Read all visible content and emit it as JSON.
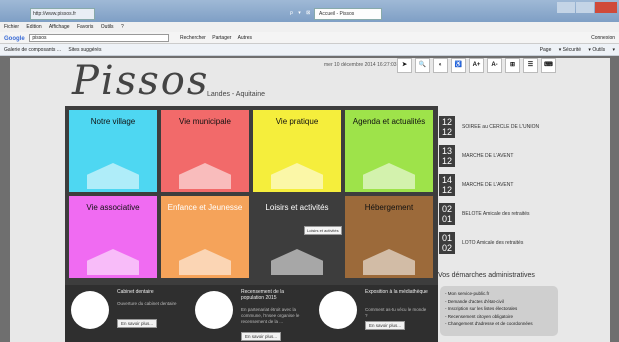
{
  "browser": {
    "tab_home": "http://www.pissos.fr",
    "tab_active": "Accueil - Pissos",
    "menu": [
      "Fichier",
      "Edition",
      "Affichage",
      "Favoris",
      "Outils",
      "?"
    ],
    "search_engine": "Google",
    "search_value": "pissos",
    "tools": [
      "Rechercher",
      "Partager",
      "Autres"
    ],
    "connexion": "Connexion",
    "favorites": [
      "Galerie de composants ...",
      "Sites suggérés"
    ],
    "right_tools": [
      "Page",
      "Sécurité",
      "Outils"
    ]
  },
  "site": {
    "logo": "Pissos",
    "region": "Landes - Aquitaine",
    "date": "mer 10 décembre 2014  16:27:03",
    "access": [
      "A+",
      "A-"
    ]
  },
  "tiles": [
    {
      "label": "Notre village",
      "color": "#4ed7f2",
      "white": false
    },
    {
      "label": "Vie municipale",
      "color": "#f26a6a",
      "white": false
    },
    {
      "label": "Vie pratique",
      "color": "#f5ee3c",
      "white": false
    },
    {
      "label": "Agenda et actualités",
      "color": "#9ee34a",
      "white": false
    },
    {
      "label": "Vie associative",
      "color": "#f06bf2",
      "white": false
    },
    {
      "label": "Enfance et Jeunesse",
      "color": "#f5a35a",
      "white": true
    },
    {
      "label": "Loisirs et activités",
      "color": "#3d3d3d",
      "white": true
    },
    {
      "label": "Hébergement",
      "color": "#9c6a3a",
      "white": false
    }
  ],
  "tooltip": "Loisirs et activités",
  "agenda": [
    {
      "day": "12",
      "month": "12",
      "label": "SOIREE au CERCLE DE L'UNION"
    },
    {
      "day": "13",
      "month": "12",
      "label": "MARCHE DE L'AVENT"
    },
    {
      "day": "14",
      "month": "12",
      "label": "MARCHE DE L'AVENT"
    },
    {
      "day": "02",
      "month": "01",
      "label": "BELOTE Amicale des retraités"
    },
    {
      "day": "01",
      "month": "02",
      "label": "LOTO Amicale des retraités"
    }
  ],
  "demarches": {
    "title": "Vos démarches administratives",
    "items": [
      "- Mon service-public.fr",
      "- Demande d'actes d'état-civil",
      "- Inscription sur les listes électorales",
      "- Recensement citoyen obligatoire",
      "- Changement d'adresse et de coordonnées"
    ]
  },
  "news": [
    {
      "title": "Cabinet dentaire",
      "text": "Ouverture du cabinet dentaire",
      "button": "En savoir plus..."
    },
    {
      "title": "Recensement de la population 2015",
      "text": "En partenariat étroit avec la commune, l'Insee organise le recensement de la ...",
      "button": "En savoir plus..."
    },
    {
      "title": "Exposition à la médiathèque",
      "text": "Comment as-tu vécu le monde ?",
      "button": "En savoir plus..."
    }
  ]
}
